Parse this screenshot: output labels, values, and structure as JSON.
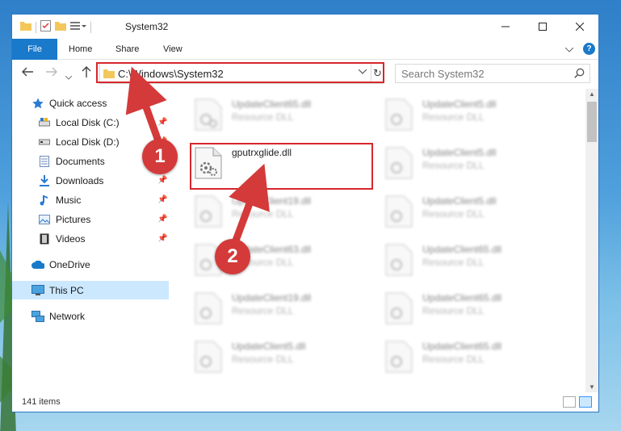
{
  "window": {
    "title": "System32"
  },
  "ribbon": {
    "tabs": [
      "File",
      "Home",
      "Share",
      "View"
    ]
  },
  "address": {
    "path": "C:\\Windows\\System32"
  },
  "search": {
    "placeholder": "Search System32"
  },
  "sidebar": {
    "items": [
      {
        "label": "Quick access",
        "icon": "star-icon",
        "pinned": false
      },
      {
        "label": "Local Disk (C:)",
        "icon": "drive-icon",
        "pinned": true
      },
      {
        "label": "Local Disk (D:)",
        "icon": "drive-icon",
        "pinned": true
      },
      {
        "label": "Documents",
        "icon": "documents-icon",
        "pinned": true
      },
      {
        "label": "Downloads",
        "icon": "download-icon",
        "pinned": true
      },
      {
        "label": "Music",
        "icon": "music-icon",
        "pinned": true
      },
      {
        "label": "Pictures",
        "icon": "pictures-icon",
        "pinned": true
      },
      {
        "label": "Videos",
        "icon": "videos-icon",
        "pinned": true
      },
      {
        "label": "OneDrive",
        "icon": "cloud-icon",
        "pinned": false
      },
      {
        "label": "This PC",
        "icon": "computer-icon",
        "pinned": false,
        "selected": true
      },
      {
        "label": "Network",
        "icon": "network-icon",
        "pinned": false
      }
    ]
  },
  "files": {
    "left": [
      {
        "name": "UpdateClient65.dll",
        "type": "Resource DLL",
        "blurred": true
      },
      {
        "name": "gputrxglide.dll",
        "type": "",
        "blurred": false
      },
      {
        "name": "UpdateClient19.dll",
        "type": "Resource DLL",
        "blurred": true
      },
      {
        "name": "UpdateClient63.dll",
        "type": "Resource DLL",
        "blurred": true
      },
      {
        "name": "UpdateClient19.dll",
        "type": "Resource DLL",
        "blurred": true
      },
      {
        "name": "UpdateClient5.dll",
        "type": "Resource DLL",
        "blurred": true
      }
    ],
    "right": [
      {
        "name": "UpdateClient5.dll",
        "type": "Resource DLL",
        "blurred": true
      },
      {
        "name": "UpdateClient5.dll",
        "type": "Resource DLL",
        "blurred": true
      },
      {
        "name": "UpdateClient5.dll",
        "type": "Resource DLL",
        "blurred": true
      },
      {
        "name": "UpdateClient65.dll",
        "type": "Resource DLL",
        "blurred": true
      },
      {
        "name": "UpdateClient65.dll",
        "type": "Resource DLL",
        "blurred": true
      },
      {
        "name": "UpdateClient65.dll",
        "type": "Resource DLL",
        "blurred": true
      }
    ]
  },
  "status": {
    "item_count": "141 items"
  },
  "annotations": {
    "step1": "1",
    "step2": "2",
    "color": "#d43a3a"
  }
}
